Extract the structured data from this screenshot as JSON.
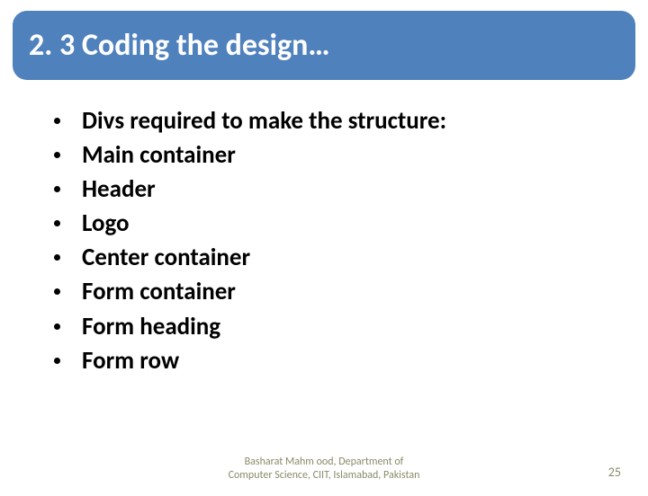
{
  "title": "2. 3 Coding the design…",
  "bullets": {
    "items": [
      "Divs required to make the structure:",
      "Main container",
      "Header",
      "Logo",
      "Center container",
      "Form container",
      "Form heading",
      "Form row"
    ]
  },
  "footer": {
    "line1": "Basharat Mahm ood, Department of",
    "line2": "Computer Science, CIIT, Islamabad, Pakistan"
  },
  "page_number": "25"
}
